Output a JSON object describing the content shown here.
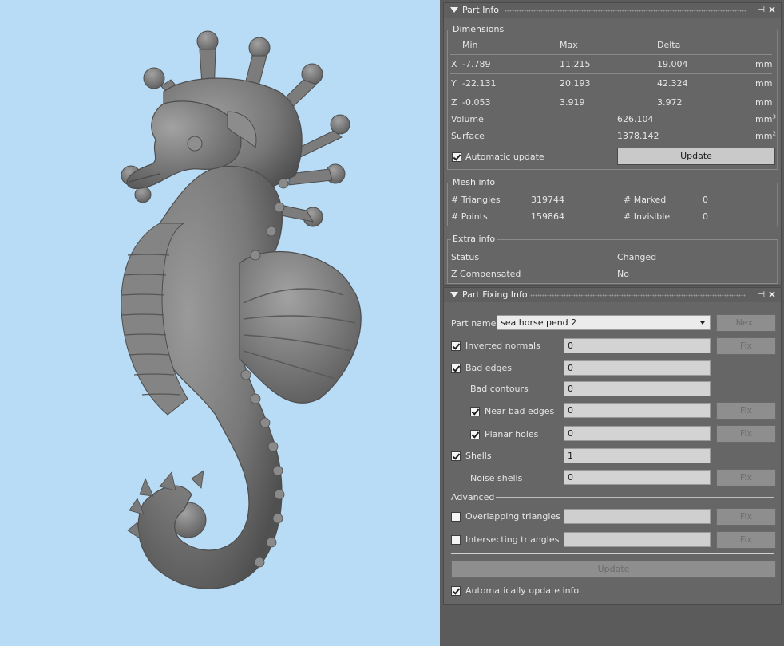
{
  "part_info": {
    "title": "Part Info",
    "dimensions": {
      "title": "Dimensions",
      "headers": [
        "Min",
        "Max",
        "Delta"
      ],
      "rows": [
        {
          "axis": "X",
          "min": "-7.789",
          "max": "11.215",
          "delta": "19.004",
          "unit": "mm"
        },
        {
          "axis": "Y",
          "min": "-22.131",
          "max": "20.193",
          "delta": "42.324",
          "unit": "mm"
        },
        {
          "axis": "Z",
          "min": "-0.053",
          "max": "3.919",
          "delta": "3.972",
          "unit": "mm"
        }
      ],
      "volume_label": "Volume",
      "volume_value": "626.104",
      "volume_unit": "mm",
      "volume_exp": "3",
      "surface_label": "Surface",
      "surface_value": "1378.142",
      "surface_unit": "mm",
      "surface_exp": "2",
      "auto_update_label": "Automatic update",
      "auto_update_checked": true,
      "update_button": "Update"
    },
    "mesh_info": {
      "title": "Mesh info",
      "triangles_label": "# Triangles",
      "triangles_value": "319744",
      "points_label": "# Points",
      "points_value": "159864",
      "marked_label": "# Marked",
      "marked_value": "0",
      "invisible_label": "# Invisible",
      "invisible_value": "0"
    },
    "extra_info": {
      "title": "Extra info",
      "status_label": "Status",
      "status_value": "Changed",
      "zcomp_label": "Z Compensated",
      "zcomp_value": "No"
    }
  },
  "part_fixing": {
    "title": "Part Fixing Info",
    "part_name_label": "Part name",
    "part_name_value": "sea horse pend 2",
    "next_button": "Next",
    "fix_label": "Fix",
    "inverted_normals_label": "Inverted normals",
    "inverted_normals_value": "0",
    "bad_edges_label": "Bad edges",
    "bad_edges_value": "0",
    "bad_contours_label": "Bad contours",
    "bad_contours_value": "0",
    "near_bad_edges_label": "Near bad edges",
    "near_bad_edges_value": "0",
    "planar_holes_label": "Planar holes",
    "planar_holes_value": "0",
    "shells_label": "Shells",
    "shells_value": "1",
    "noise_shells_label": "Noise shells",
    "noise_shells_value": "0",
    "advanced_label": "Advanced",
    "overlapping_label": "Overlapping triangles",
    "intersecting_label": "Intersecting triangles",
    "update_button": "Update",
    "auto_update_info_label": "Automatically update info"
  },
  "colors": {
    "viewport_bg": "#b9dcf6",
    "panel_bg": "#666666",
    "model_gray": "#7a7a7a"
  }
}
